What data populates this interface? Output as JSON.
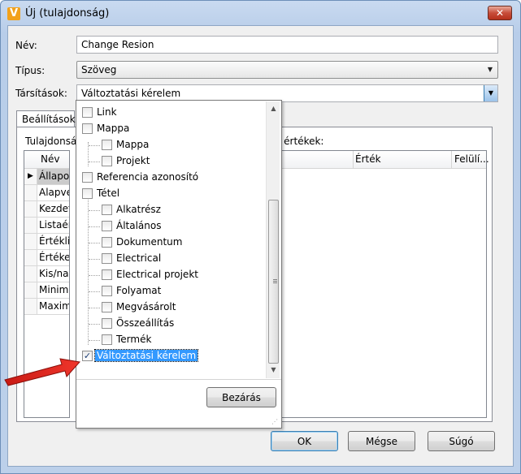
{
  "window": {
    "title": "Új (tulajdonság)",
    "icon": "app-v-icon",
    "close_label": "✕"
  },
  "form": {
    "name_label": "Név:",
    "name_value": "Change Resion",
    "type_label": "Típus:",
    "type_value": "Szöveg",
    "assoc_label": "Társítások:",
    "assoc_value": "Változtatási kérelem"
  },
  "tab": {
    "label": "Beállítások"
  },
  "panel": {
    "left_caption": "Tulajdonsá",
    "right_caption": "a értékek:",
    "grid_header": "Név",
    "rows": [
      "Állapot",
      "Alapvet",
      "Kezdeti",
      "Listaért",
      "Értéklist",
      "Értéket",
      "Kis/nag",
      "Minimá",
      "Maxima"
    ],
    "right_columns": [
      "Érték",
      "Felülí..."
    ]
  },
  "tree": {
    "items": [
      {
        "label": "Link",
        "checked": false,
        "level": 0
      },
      {
        "label": "Mappa",
        "checked": false,
        "level": 0
      },
      {
        "label": "Mappa",
        "checked": false,
        "level": 1
      },
      {
        "label": "Projekt",
        "checked": false,
        "level": 1
      },
      {
        "label": "Referencia azonosító",
        "checked": false,
        "level": 0
      },
      {
        "label": "Tétel",
        "checked": false,
        "level": 0
      },
      {
        "label": "Alkatrész",
        "checked": false,
        "level": 1
      },
      {
        "label": "Általános",
        "checked": false,
        "level": 1
      },
      {
        "label": "Dokumentum",
        "checked": false,
        "level": 1
      },
      {
        "label": "Electrical",
        "checked": false,
        "level": 1
      },
      {
        "label": "Electrical projekt",
        "checked": false,
        "level": 1
      },
      {
        "label": "Folyamat",
        "checked": false,
        "level": 1
      },
      {
        "label": "Megvásárolt",
        "checked": false,
        "level": 1
      },
      {
        "label": "Összeállítás",
        "checked": false,
        "level": 1
      },
      {
        "label": "Termék",
        "checked": false,
        "level": 1
      },
      {
        "label": "Változtatási kérelem",
        "checked": true,
        "level": 0,
        "selected": true
      }
    ],
    "close_button": "Bezárás"
  },
  "buttons": {
    "ok": "OK",
    "cancel": "Mégse",
    "help": "Súgó"
  },
  "colors": {
    "selection": "#3399ff",
    "arrow": "#e0231b"
  }
}
